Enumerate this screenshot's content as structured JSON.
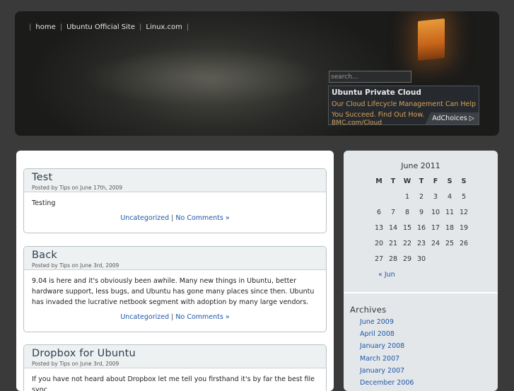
{
  "header": {
    "nav": [
      {
        "label": "home"
      },
      {
        "label": "Ubuntu Official Site"
      },
      {
        "label": "Linux.com"
      }
    ],
    "search": {
      "placeholder": "search..."
    },
    "ad": {
      "title": "Ubuntu Private Cloud",
      "text": "Our Cloud Lifecycle Management Can Help You Succeed. Find Out How.",
      "url": "BMC.com/Cloud",
      "choices_label": "AdChoices ▷"
    }
  },
  "posts": [
    {
      "title": "Test",
      "meta": "Posted by Tips on June 17th, 2009",
      "body": "Testing",
      "category": "Uncategorized",
      "separator": " | ",
      "comments": "No Comments »"
    },
    {
      "title": "Back",
      "meta": "Posted by Tips on June 3rd, 2009",
      "body": "9.04 is here and it's obviously been awhile. Many new things in Ubuntu, better hardware support, less bugs, and Ubuntu has gone many places since then. Ubuntu has invaded the lucrative netbook segment with adoption by many large vendors.",
      "category": "Uncategorized",
      "separator": " | ",
      "comments": "No Comments »"
    },
    {
      "title": "Dropbox for Ubuntu",
      "meta": "Posted by Tips on June 3rd, 2009",
      "body": "If you have not heard about Dropbox let me tell you firsthand it's by far the best file sync"
    }
  ],
  "calendar": {
    "caption": "June 2011",
    "weekdays": [
      "M",
      "T",
      "W",
      "T",
      "F",
      "S",
      "S"
    ],
    "weeks": [
      [
        "",
        "",
        "1",
        "2",
        "3",
        "4",
        "5"
      ],
      [
        "6",
        "7",
        "8",
        "9",
        "10",
        "11",
        "12"
      ],
      [
        "13",
        "14",
        "15",
        "16",
        "17",
        "18",
        "19"
      ],
      [
        "20",
        "21",
        "22",
        "23",
        "24",
        "25",
        "26"
      ],
      [
        "27",
        "28",
        "29",
        "30",
        "",
        "",
        ""
      ]
    ],
    "prev": "« Jun"
  },
  "archives": {
    "title": "Archives",
    "items": [
      "June 2009",
      "April 2008",
      "January 2008",
      "March 2007",
      "January 2007",
      "December 2006"
    ]
  }
}
